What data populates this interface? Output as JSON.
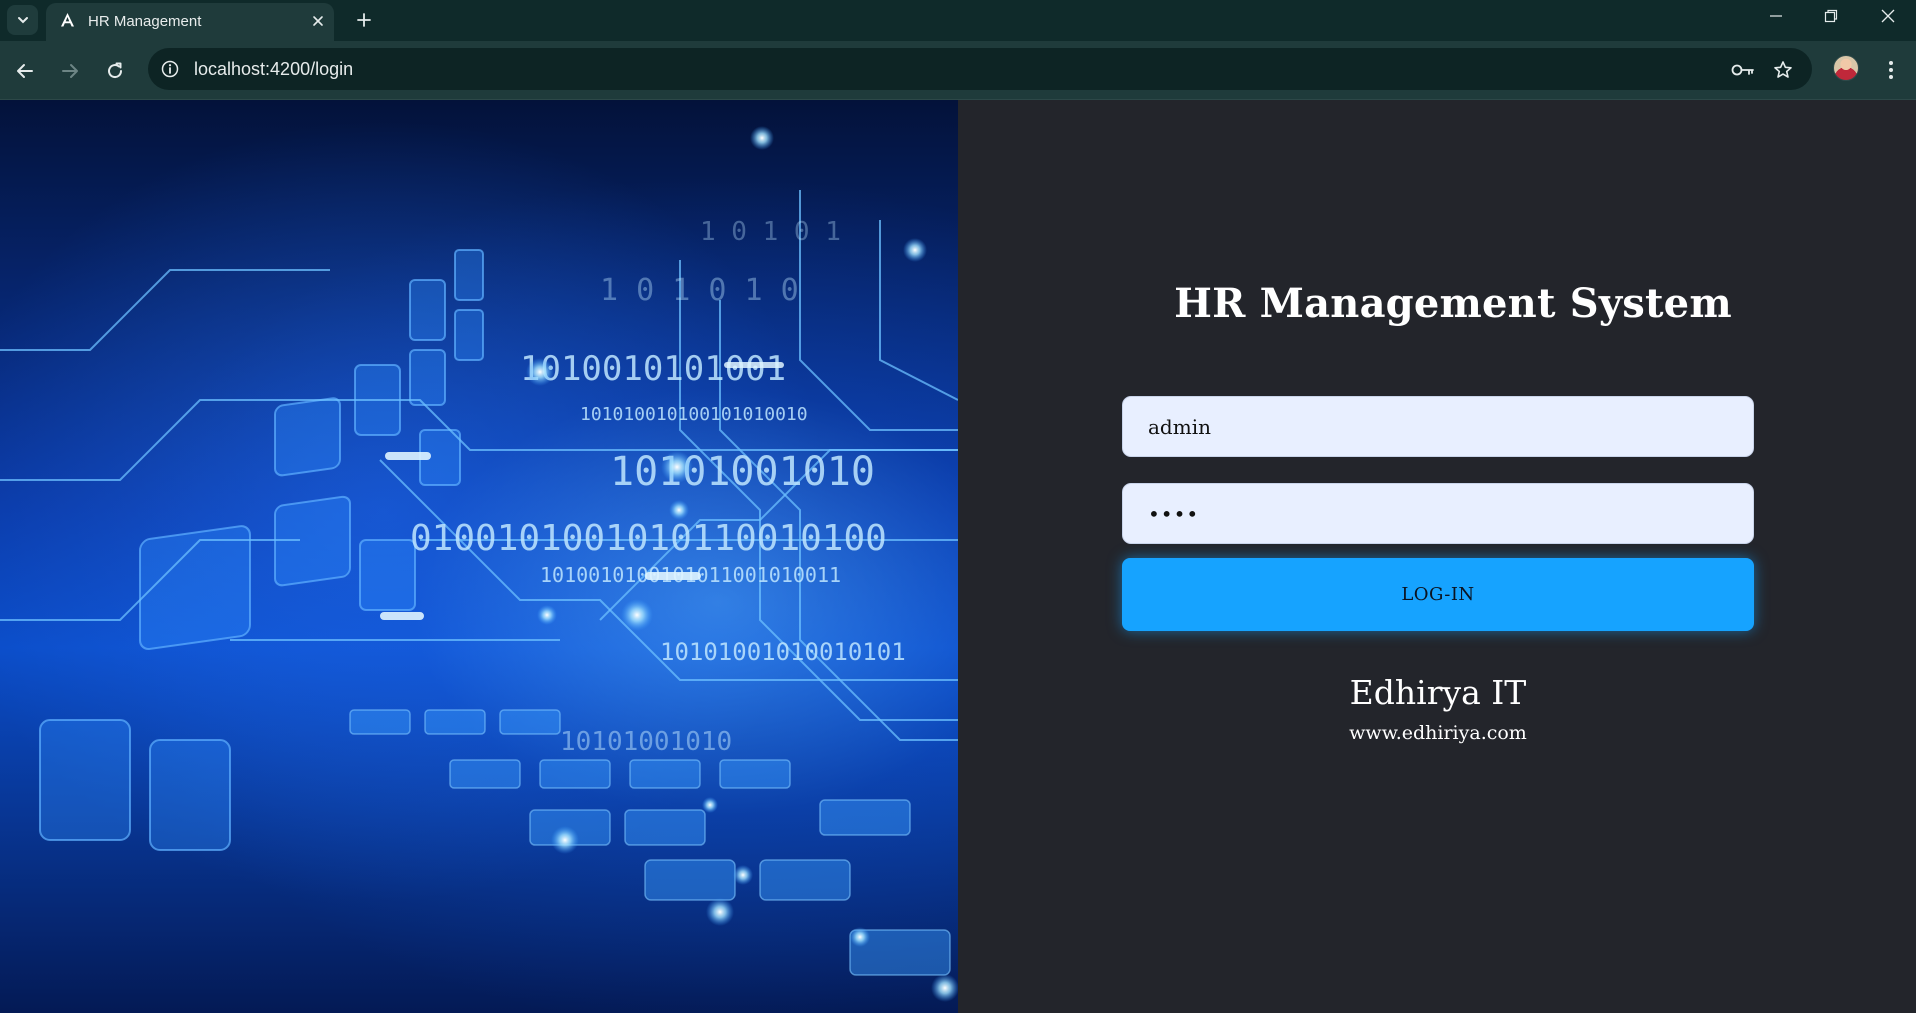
{
  "browser": {
    "tab_title": "HR Management",
    "url": "localhost:4200/login",
    "icons": {
      "tab_list": "chevron-down-icon",
      "favicon": "angular-icon",
      "close_tab": "close-icon",
      "new_tab": "plus-icon",
      "minimize": "minimize-icon",
      "restore": "restore-icon",
      "close_window": "close-icon",
      "back": "arrow-left-icon",
      "forward": "arrow-right-icon",
      "reload": "reload-icon",
      "site_info": "info-icon",
      "password": "key-icon",
      "bookmark": "star-icon",
      "profile": "avatar",
      "menu": "kebab-menu-icon"
    }
  },
  "login": {
    "title": "HR Management System",
    "username_value": "admin",
    "password_value": "••••",
    "button_label": "LOG-IN",
    "brand_name": "Edhirya IT",
    "brand_url": "www.edhiriya.com"
  },
  "colors": {
    "page_background": "#23252b",
    "input_background": "#e8efff",
    "button_background": "#16a3ff",
    "chrome_dark": "#0f2a2a",
    "chrome_toolbar": "#1f3b3b"
  }
}
